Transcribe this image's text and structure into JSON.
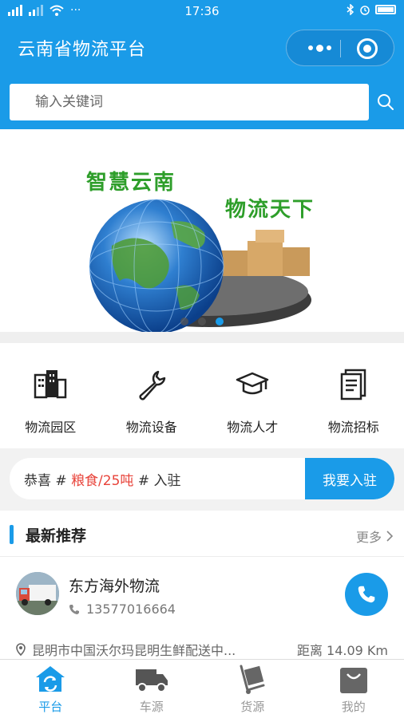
{
  "status_bar": {
    "signal_left": "4G",
    "signal_right": "2G",
    "more": "···",
    "time": "17:36"
  },
  "header": {
    "title": "云南省物流平台"
  },
  "search": {
    "placeholder": "输入关键词"
  },
  "banner": {
    "text1": "智慧云南",
    "text2": "物流天下",
    "slide_count": 3,
    "active_slide": 3
  },
  "categories": [
    {
      "label": "物流园区",
      "icon": "building-icon"
    },
    {
      "label": "物流设备",
      "icon": "wrench-icon"
    },
    {
      "label": "物流人才",
      "icon": "graduation-cap-icon"
    },
    {
      "label": "物流招标",
      "icon": "document-icon"
    }
  ],
  "notice": {
    "prefix": "恭喜 # ",
    "highlight": "粮食/25吨",
    "suffix": " # 入驻",
    "button": "我要入驻"
  },
  "recommend": {
    "title": "最新推荐",
    "more": "更多",
    "company": {
      "name": "东方海外物流",
      "phone": "13577016664",
      "address": "昆明市中国沃尔玛昆明生鲜配送中...",
      "distance": "距离 14.09 Km"
    }
  },
  "tabbar": [
    {
      "label": "平台",
      "icon": "platform-icon",
      "active": true
    },
    {
      "label": "车源",
      "icon": "truck-icon",
      "active": false
    },
    {
      "label": "货源",
      "icon": "cargo-icon",
      "active": false
    },
    {
      "label": "我的",
      "icon": "bag-icon",
      "active": false
    }
  ],
  "colors": {
    "primary": "#1a9be8",
    "highlight": "#e8433a",
    "banner_text": "#2e9e2a"
  }
}
